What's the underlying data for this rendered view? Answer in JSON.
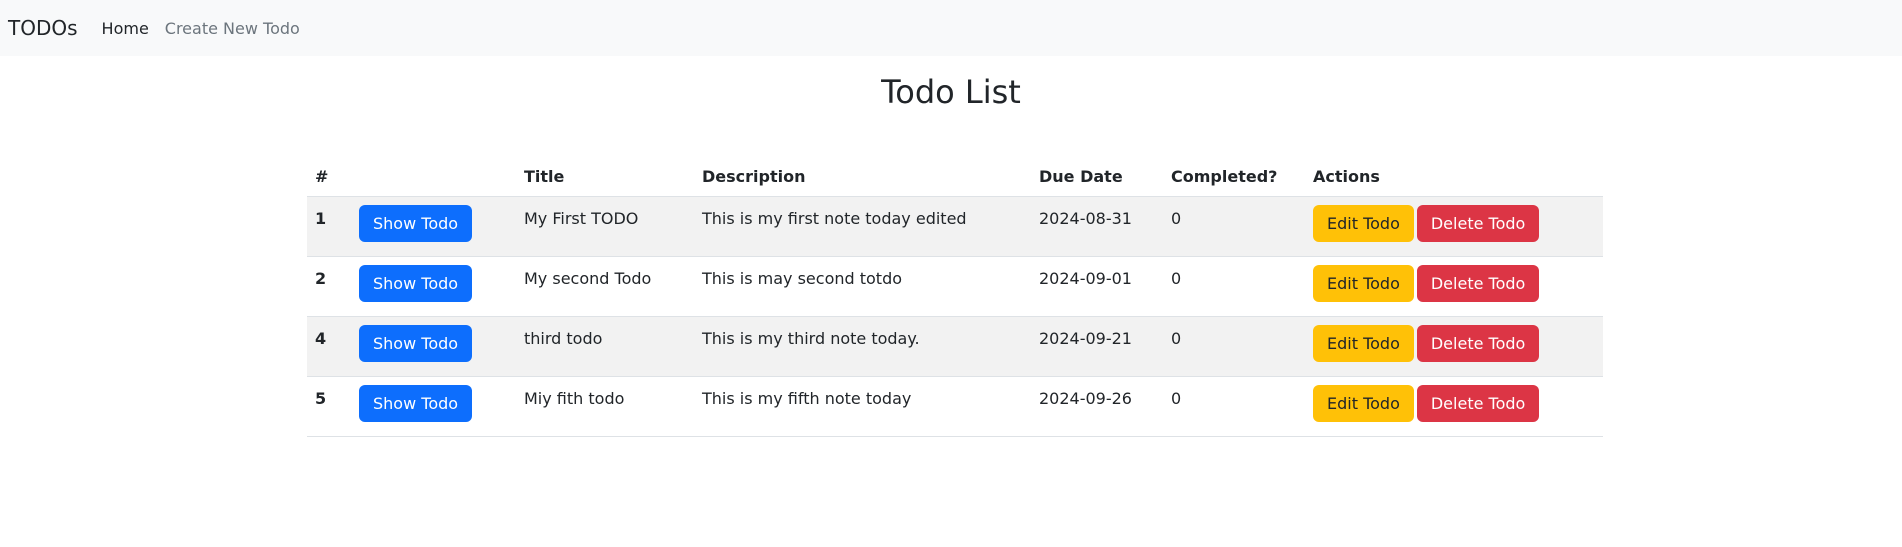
{
  "nav": {
    "brand": "TODOs",
    "links": [
      {
        "label": "Home"
      },
      {
        "label": "Create New Todo"
      }
    ]
  },
  "page": {
    "title": "Todo List"
  },
  "table": {
    "headers": [
      "#",
      "",
      "Title",
      "Description",
      "Due Date",
      "Completed?",
      "Actions"
    ],
    "rows": [
      {
        "id": "1",
        "title": "My First TODO",
        "description": "This is my first note today edited",
        "due_date": "2024-08-31",
        "completed": "0"
      },
      {
        "id": "2",
        "title": "My second Todo",
        "description": "This is may second totdo",
        "due_date": "2024-09-01",
        "completed": "0"
      },
      {
        "id": "4",
        "title": "third todo",
        "description": "This is my third note today.",
        "due_date": "2024-09-21",
        "completed": "0"
      },
      {
        "id": "5",
        "title": "Miy fith todo",
        "description": "This is my fifth note today",
        "due_date": "2024-09-26",
        "completed": "0"
      }
    ],
    "show_label": "Show Todo",
    "edit_label": "Edit Todo",
    "delete_label": "Delete Todo"
  },
  "colors": {
    "primary": "#0d6efd",
    "warning": "#ffc107",
    "danger": "#dc3545",
    "navbar_bg": "#f8f9fa",
    "stripe": "#f2f2f2"
  }
}
